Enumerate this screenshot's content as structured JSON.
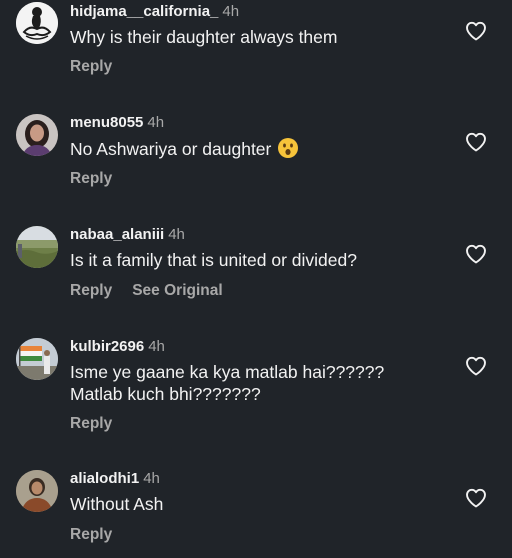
{
  "comments": [
    {
      "username": "hidjama__california_",
      "time": "4h",
      "lines": [
        "Why is their daughter always them"
      ],
      "reply": "Reply",
      "avatar": "white-decorative-logo-avatar"
    },
    {
      "username": "menu8055",
      "time": "4h",
      "lines": [
        "No Ashwariya or daughter"
      ],
      "emoji": "astonished-face-emoji",
      "reply": "Reply",
      "avatar": "woman-portrait-avatar"
    },
    {
      "username": "nabaa_alaniii",
      "time": "4h",
      "lines": [
        "Is it a family that is united or divided?"
      ],
      "reply": "Reply",
      "see_original": "See Original",
      "avatar": "landscape-photo-avatar"
    },
    {
      "username": "kulbir2696",
      "time": "4h",
      "lines": [
        "Isme ye  gaane ka kya matlab hai??????",
        "Matlab kuch bhi???????"
      ],
      "reply": "Reply",
      "avatar": "flag-photo-avatar"
    },
    {
      "username": "alialodhi1",
      "time": "4h",
      "lines": [
        "Without Ash"
      ],
      "reply": "Reply",
      "avatar": "person-portrait-avatar"
    }
  ],
  "colors": {
    "background": "#202429",
    "text": "#f2f2f2",
    "secondary": "#a8a8a8"
  },
  "icons": {
    "like": "heart-outline-icon"
  }
}
